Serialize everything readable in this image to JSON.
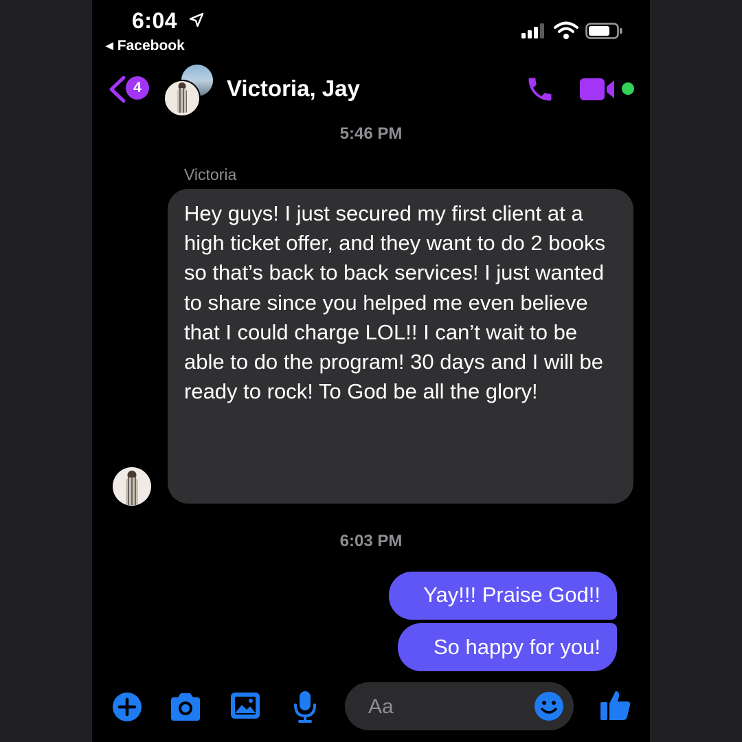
{
  "status_bar": {
    "time": "6:04",
    "back_app": "Facebook"
  },
  "header": {
    "unread_count": "4",
    "title": "Victoria, Jay",
    "accent_color": "#a335f7",
    "active_color": "#32d15a"
  },
  "messages": {
    "timestamp_1": "5:46 PM",
    "sender_name": "Victoria",
    "incoming_text": "Hey guys! I just secured my first client at a high ticket offer, and they want to do 2 books so that’s back to back services! I just wanted to share since you helped me even believe that I could charge LOL!! I can’t wait to be able to do the program! 30 days and I will be ready to rock! To God be all the glory!",
    "timestamp_2": "6:03 PM",
    "outgoing": [
      "Yay!!! Praise God!!",
      "So happy for you!"
    ],
    "outgoing_color": "#6055f5",
    "incoming_color": "#303033"
  },
  "composer": {
    "placeholder": "Aa",
    "icons": [
      "plus-icon",
      "camera-icon",
      "photo-icon",
      "microphone-icon",
      "emoji-icon",
      "thumbs-up-icon"
    ],
    "icon_color": "#1e7bf2"
  }
}
